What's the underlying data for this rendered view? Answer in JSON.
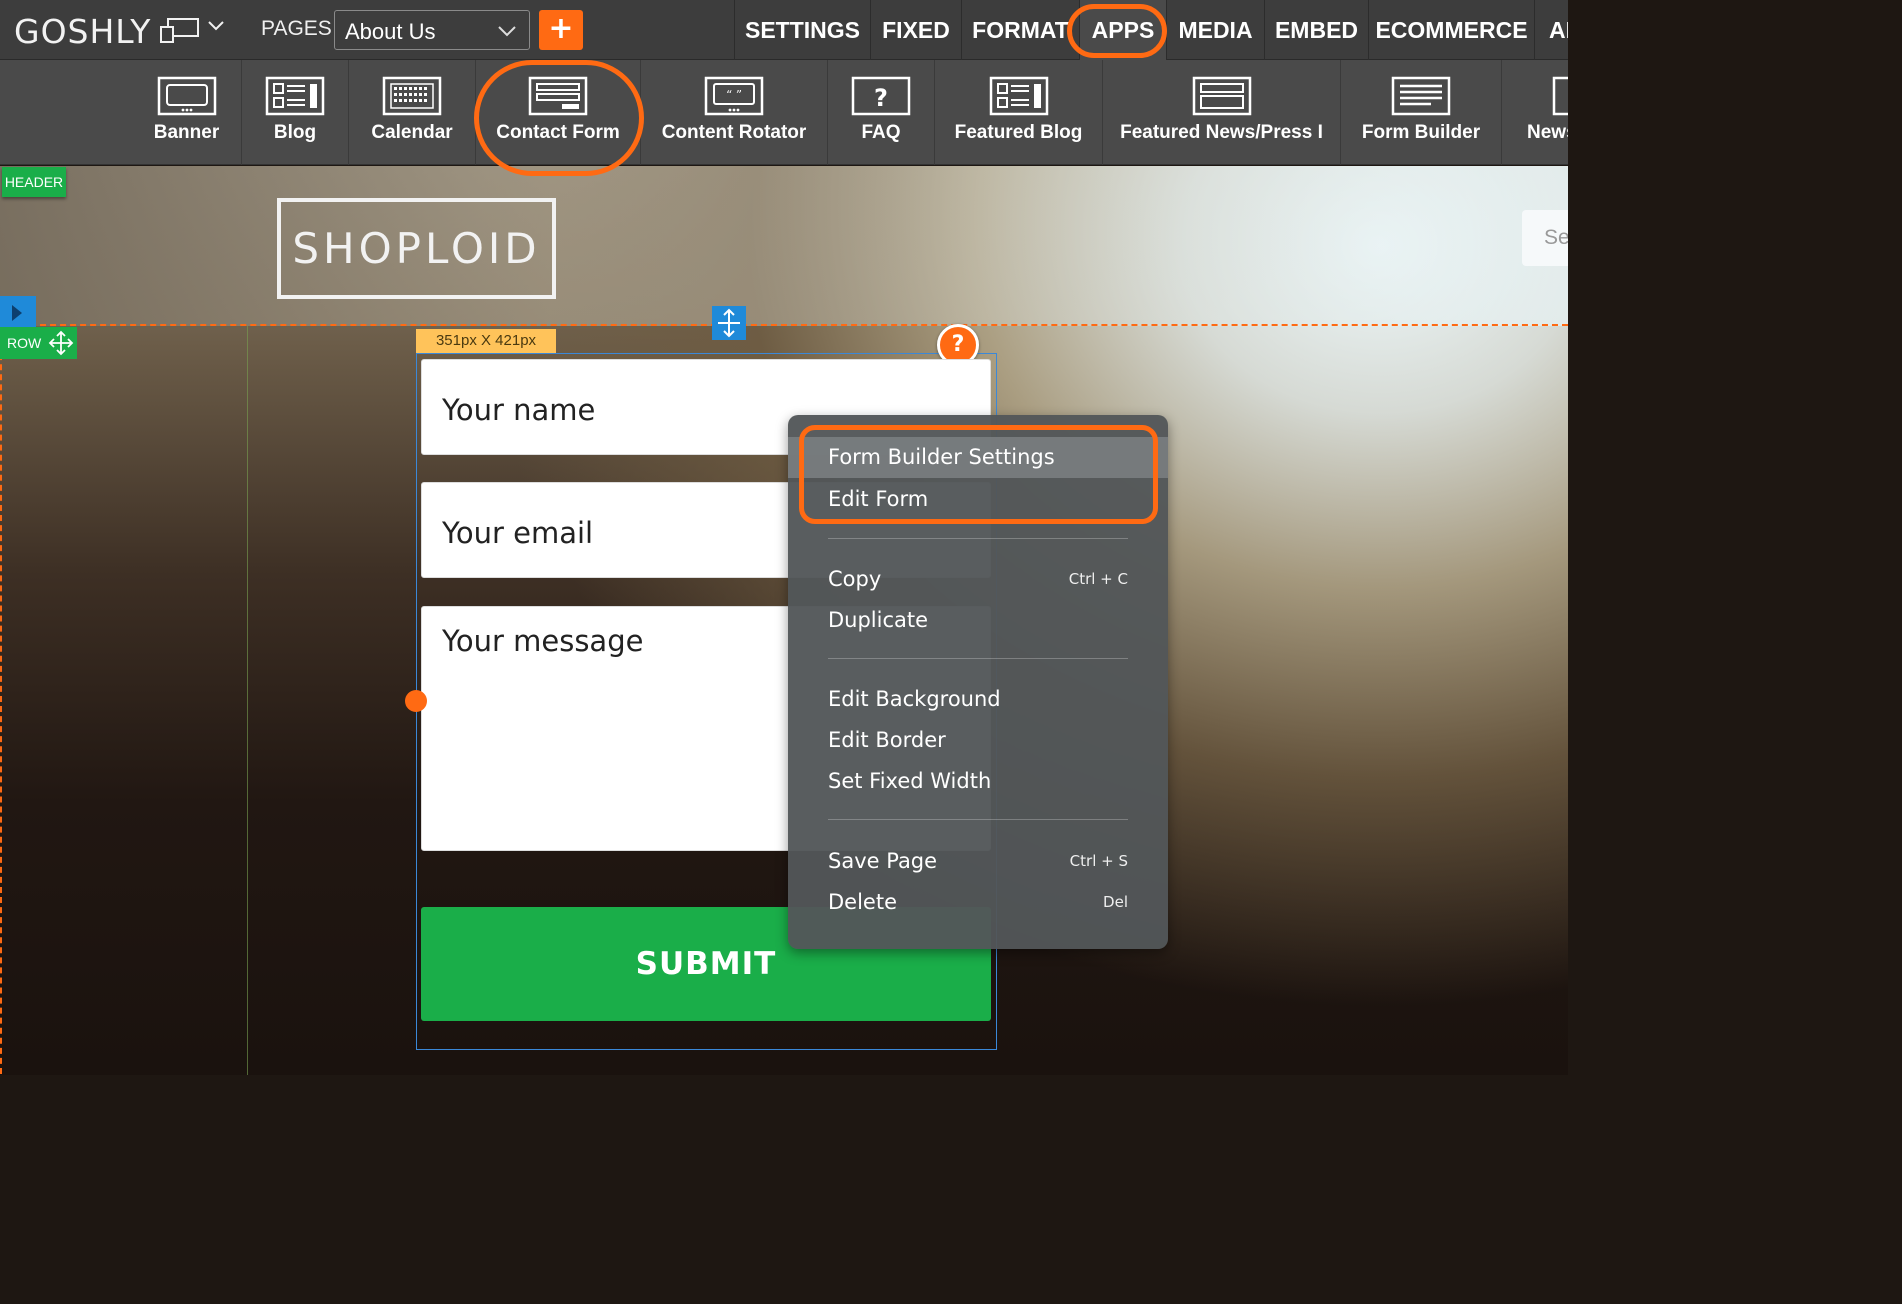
{
  "topbar": {
    "logo_text": "GOSHLY",
    "pages_label": "PAGES",
    "current_page": "About Us",
    "add_page_label": "+",
    "menu": [
      {
        "label": "SETTINGS",
        "active": false
      },
      {
        "label": "FIXED",
        "active": false
      },
      {
        "label": "FORMAT",
        "active": false
      },
      {
        "label": "APPS",
        "active": true
      },
      {
        "label": "MEDIA",
        "active": false
      },
      {
        "label": "EMBED",
        "active": false
      },
      {
        "label": "ECOMMERCE",
        "active": false
      },
      {
        "label": "AI",
        "active": false
      }
    ]
  },
  "apps": [
    {
      "label": "Banner",
      "icon": "banner-icon"
    },
    {
      "label": "Blog",
      "icon": "blog-icon"
    },
    {
      "label": "Calendar",
      "icon": "calendar-icon"
    },
    {
      "label": "Contact Form",
      "icon": "contact-form-icon"
    },
    {
      "label": "Content Rotator",
      "icon": "content-rotator-icon"
    },
    {
      "label": "FAQ",
      "icon": "faq-icon"
    },
    {
      "label": "Featured Blog",
      "icon": "featured-blog-icon"
    },
    {
      "label": "Featured News/Press I",
      "icon": "featured-news-icon"
    },
    {
      "label": "Form Builder",
      "icon": "form-builder-icon"
    },
    {
      "label": "News",
      "icon": "news-icon"
    }
  ],
  "canvas": {
    "header_badge": "HEADER",
    "row_badge": "ROW",
    "brand_logo": "SHOPLOID",
    "search_placeholder": "Se",
    "size_label": "351px X 421px",
    "help_label": "?",
    "form": {
      "name_placeholder": "Your name",
      "email_placeholder": "Your email",
      "message_placeholder": "Your message",
      "submit_label": "SUBMIT"
    }
  },
  "context_menu": {
    "items": [
      {
        "label": "Form Builder Settings",
        "shortcut": "",
        "highlighted": true
      },
      {
        "label": "Edit Form",
        "shortcut": "",
        "highlighted": false
      },
      {
        "label": "Copy",
        "shortcut": "Ctrl + C",
        "highlighted": false
      },
      {
        "label": "Duplicate",
        "shortcut": "",
        "highlighted": false
      },
      {
        "label": "Edit Background",
        "shortcut": "",
        "highlighted": false
      },
      {
        "label": "Edit Border",
        "shortcut": "",
        "highlighted": false
      },
      {
        "label": "Set Fixed Width",
        "shortcut": "",
        "highlighted": false
      },
      {
        "label": "Save Page",
        "shortcut": "Ctrl + S",
        "highlighted": false
      },
      {
        "label": "Delete",
        "shortcut": "Del",
        "highlighted": false
      }
    ]
  },
  "colors": {
    "accent_orange": "#ff6a13",
    "green": "#1aae49",
    "blue": "#1f8ad9",
    "toolbar_dark": "#3d3d3d",
    "toolbar_mid": "#4a4a4a"
  }
}
